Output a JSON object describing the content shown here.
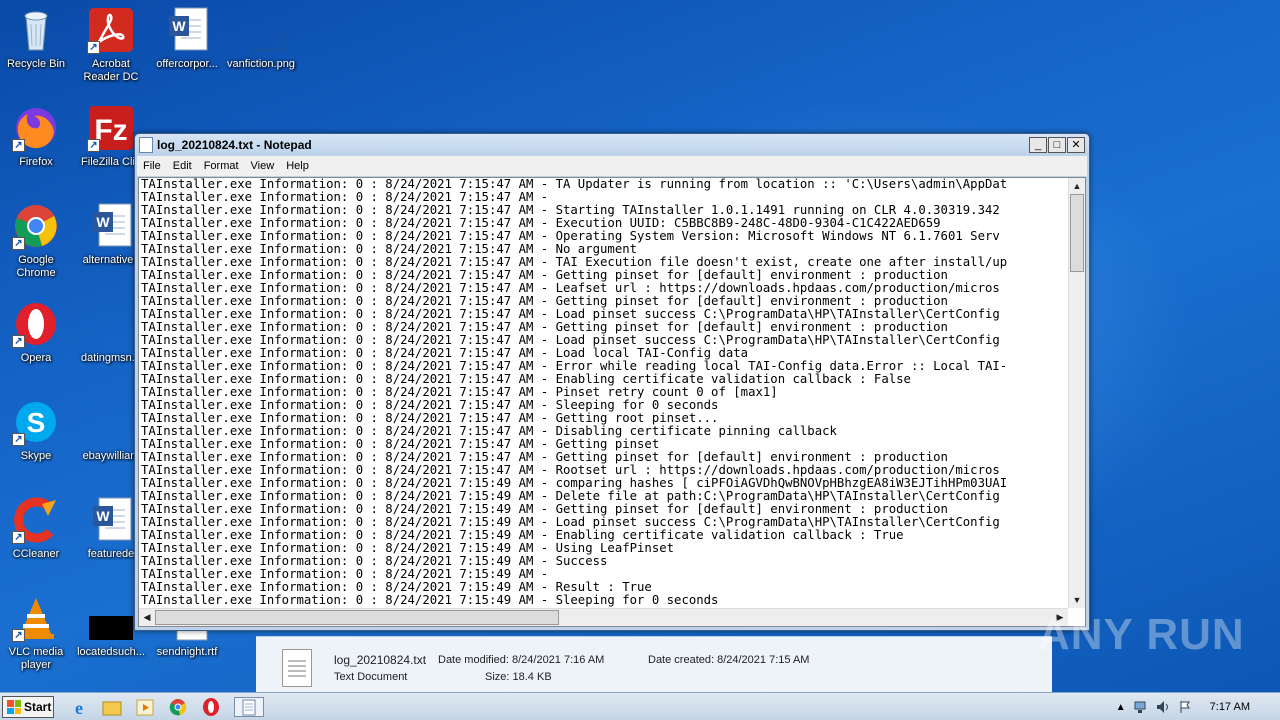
{
  "desktop": {
    "icons": [
      {
        "label": "Recycle Bin",
        "icon": "recycle-bin-icon"
      },
      {
        "label": "Acrobat Reader DC",
        "icon": "acrobat-icon"
      },
      {
        "label": "offercorpor...",
        "icon": "word-doc-icon"
      },
      {
        "label": "vanfiction.png",
        "icon": "image-file-icon"
      },
      {
        "label": "Firefox",
        "icon": "firefox-icon"
      },
      {
        "label": "FileZilla Clie",
        "icon": "filezilla-icon"
      },
      {
        "label": "Google Chrome",
        "icon": "chrome-icon"
      },
      {
        "label": "alternativep",
        "icon": "word-doc-icon"
      },
      {
        "label": "Opera",
        "icon": "opera-icon"
      },
      {
        "label": "datingmsn.p",
        "icon": "file-icon"
      },
      {
        "label": "Skype",
        "icon": "skype-icon"
      },
      {
        "label": "ebaywilliam",
        "icon": "file-icon"
      },
      {
        "label": "CCleaner",
        "icon": "ccleaner-icon"
      },
      {
        "label": "featurede",
        "icon": "word-doc-icon"
      },
      {
        "label": "VLC media player",
        "icon": "vlc-icon"
      },
      {
        "label": "locatedsuch...",
        "icon": "black-file-icon"
      },
      {
        "label": "sendnight.rtf",
        "icon": "rtf-file-icon"
      }
    ]
  },
  "notepad": {
    "title": "log_20210824.txt - Notepad",
    "menu": [
      "File",
      "Edit",
      "Format",
      "View",
      "Help"
    ],
    "lines": [
      "TAInstaller.exe Information: 0 : 8/24/2021 7:15:47 AM - TA Updater is running from location :: 'C:\\Users\\admin\\AppDat",
      "TAInstaller.exe Information: 0 : 8/24/2021 7:15:47 AM -",
      "TAInstaller.exe Information: 0 : 8/24/2021 7:15:47 AM - Starting TAInstaller 1.0.1.1491 running on CLR 4.0.30319.342",
      "TAInstaller.exe Information: 0 : 8/24/2021 7:15:47 AM - Execution UUID: C5BBC8B9-248C-48D0-9304-C1C422AED659",
      "TAInstaller.exe Information: 0 : 8/24/2021 7:15:47 AM - Operating System Version: Microsoft Windows NT 6.1.7601 Serv",
      "TAInstaller.exe Information: 0 : 8/24/2021 7:15:47 AM - No argument",
      "TAInstaller.exe Information: 0 : 8/24/2021 7:15:47 AM - TAI Execution file doesn't exist, create one after install/up",
      "TAInstaller.exe Information: 0 : 8/24/2021 7:15:47 AM - Getting pinset for [default] environment : production",
      "TAInstaller.exe Information: 0 : 8/24/2021 7:15:47 AM - Leafset url : https://downloads.hpdaas.com/production/micros",
      "TAInstaller.exe Information: 0 : 8/24/2021 7:15:47 AM - Getting pinset for [default] environment : production",
      "TAInstaller.exe Information: 0 : 8/24/2021 7:15:47 AM - Load pinset success C:\\ProgramData\\HP\\TAInstaller\\CertConfig",
      "TAInstaller.exe Information: 0 : 8/24/2021 7:15:47 AM - Getting pinset for [default] environment : production",
      "TAInstaller.exe Information: 0 : 8/24/2021 7:15:47 AM - Load pinset success C:\\ProgramData\\HP\\TAInstaller\\CertConfig",
      "TAInstaller.exe Information: 0 : 8/24/2021 7:15:47 AM - Load local TAI-Config data",
      "TAInstaller.exe Information: 0 : 8/24/2021 7:15:47 AM - Error while reading local TAI-Config data.Error :: Local TAI-",
      "TAInstaller.exe Information: 0 : 8/24/2021 7:15:47 AM - Enabling certificate validation callback : False",
      "TAInstaller.exe Information: 0 : 8/24/2021 7:15:47 AM - Pinset retry count 0 of [max1]",
      "TAInstaller.exe Information: 0 : 8/24/2021 7:15:47 AM - Sleeping for 0 seconds",
      "TAInstaller.exe Information: 0 : 8/24/2021 7:15:47 AM - Getting root pinset...",
      "TAInstaller.exe Information: 0 : 8/24/2021 7:15:47 AM - Disabling certificate pinning callback",
      "TAInstaller.exe Information: 0 : 8/24/2021 7:15:47 AM - Getting pinset",
      "TAInstaller.exe Information: 0 : 8/24/2021 7:15:47 AM - Getting pinset for [default] environment : production",
      "TAInstaller.exe Information: 0 : 8/24/2021 7:15:47 AM - Rootset url : https://downloads.hpdaas.com/production/micros",
      "TAInstaller.exe Information: 0 : 8/24/2021 7:15:49 AM - comparing hashes [ ciPFOiAGVDhQwBNOVpHBhzgEA8iW3EJTihHPm03UAI",
      "TAInstaller.exe Information: 0 : 8/24/2021 7:15:49 AM - Delete file at path:C:\\ProgramData\\HP\\TAInstaller\\CertConfig",
      "TAInstaller.exe Information: 0 : 8/24/2021 7:15:49 AM - Getting pinset for [default] environment : production",
      "TAInstaller.exe Information: 0 : 8/24/2021 7:15:49 AM - Load pinset success C:\\ProgramData\\HP\\TAInstaller\\CertConfig",
      "TAInstaller.exe Information: 0 : 8/24/2021 7:15:49 AM - Enabling certificate validation callback : True",
      "TAInstaller.exe Information: 0 : 8/24/2021 7:15:49 AM - Using LeafPinset",
      "TAInstaller.exe Information: 0 : 8/24/2021 7:15:49 AM - Success",
      "TAInstaller.exe Information: 0 : 8/24/2021 7:15:49 AM -",
      "TAInstaller.exe Information: 0 : 8/24/2021 7:15:49 AM - Result : True",
      "TAInstaller.exe Information: 0 : 8/24/2021 7:15:49 AM - Sleeping for 0 seconds"
    ]
  },
  "details": {
    "file_name": "log_20210824.txt",
    "modified": "Date modified: 8/24/2021 7:16 AM",
    "created": "Date created: 8/24/2021 7:15 AM",
    "type": "Text Document",
    "size": "Size: 18.4 KB"
  },
  "taskbar": {
    "start_label": "Start",
    "clock": "7:17 AM"
  },
  "watermark": "ANY RUN"
}
